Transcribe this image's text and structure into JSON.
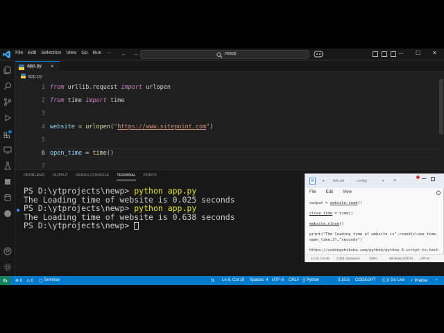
{
  "menu": [
    "File",
    "Edit",
    "Selection",
    "View",
    "Go",
    "Run",
    "···"
  ],
  "nav": {
    "back": "←",
    "forward": "→"
  },
  "search": {
    "label": "newp"
  },
  "window_controls": {
    "minimize": "—",
    "restore": "☐",
    "close": "✕"
  },
  "editor": {
    "tab": {
      "label": "app.py",
      "close": "×"
    },
    "breadcrumb": "app.py",
    "lines": [
      {
        "num": "1",
        "parts": [
          [
            "kw",
            "from"
          ],
          [
            "plain",
            " urllib.request "
          ],
          [
            "kw",
            "import"
          ],
          [
            "plain",
            " urlopen"
          ]
        ]
      },
      {
        "num": "2",
        "parts": [
          [
            "kw",
            "from"
          ],
          [
            "plain",
            " time "
          ],
          [
            "kw",
            "import"
          ],
          [
            "plain",
            " time"
          ]
        ]
      },
      {
        "num": "3",
        "parts": []
      },
      {
        "num": "4",
        "parts": [
          [
            "var",
            "website"
          ],
          [
            "plain",
            " = "
          ],
          [
            "fn",
            "urlopen"
          ],
          [
            "plain",
            "("
          ],
          [
            "str",
            "\""
          ],
          [
            "strurl",
            "https://www.sitepoint.com"
          ],
          [
            "str",
            "\""
          ],
          [
            "plain",
            ")"
          ]
        ]
      },
      {
        "num": "5",
        "parts": []
      },
      {
        "num": "6",
        "parts": [
          [
            "var",
            "open_time"
          ],
          [
            "plain",
            " = "
          ],
          [
            "fn",
            "time"
          ],
          [
            "plain",
            "()"
          ]
        ]
      },
      {
        "num": "7",
        "parts": []
      }
    ]
  },
  "panel": {
    "tabs": [
      "PROBLEMS",
      "OUTPUT",
      "DEBUG CONSOLE",
      "TERMINAL",
      "PORTS"
    ],
    "active_tab": "TERMINAL",
    "terminal": [
      {
        "prompt": "PS D:\\ytprojects\\newp> ",
        "cmd": "python app.py"
      },
      {
        "text": "The Loading time of website is 0.025 seconds"
      },
      {
        "prompt": "PS D:\\ytprojects\\newp> ",
        "cmd": "python app.py"
      },
      {
        "text": "The Loading time of website is 0.638 seconds"
      },
      {
        "prompt": "PS D:\\ytprojects\\newp> ",
        "cursor": true
      }
    ]
  },
  "notepad": {
    "tabs": [
      "info.txt",
      "config"
    ],
    "new_tab": "+",
    "menu": [
      "File",
      "Edit",
      "View"
    ],
    "lines": [
      [
        [
          "plain",
          "output = "
        ],
        [
          "u",
          "website.read"
        ],
        [
          "plain",
          "()"
        ]
      ],
      [],
      [
        [
          "u",
          "close_time"
        ],
        [
          "plain",
          " = time()"
        ]
      ],
      [],
      [
        [
          "u",
          "website.close"
        ],
        [
          "plain",
          "()"
        ]
      ],
      [],
      [
        [
          "plain",
          "print(\"The loading time of website is\",round(close_time-"
        ]
      ],
      [
        [
          "plain",
          "open_time,3),\"seconds\")"
        ]
      ],
      [],
      [
        [
          "plain",
          "https://codingshiksha.com/python/python-3-script-to-test-"
        ]
      ]
    ],
    "status": [
      "Ln 23, Col 30",
      "3,383 characters",
      "100%",
      "Windows (CRLF)",
      "UTF-8"
    ]
  },
  "statusbar": {
    "errors": "⊗ 0",
    "warnings": "⚠ 0",
    "terminal": "Terminal",
    "position": "Ln 6, Col 19",
    "spaces": "Spaces: 4",
    "encoding": "UTF-8",
    "eol": "CRLF",
    "language": "{} Python",
    "version": "3.10.5",
    "ext": "CODEGPT",
    "golive": "((·)) Go Live",
    "prettier": "✓ Prettier"
  }
}
